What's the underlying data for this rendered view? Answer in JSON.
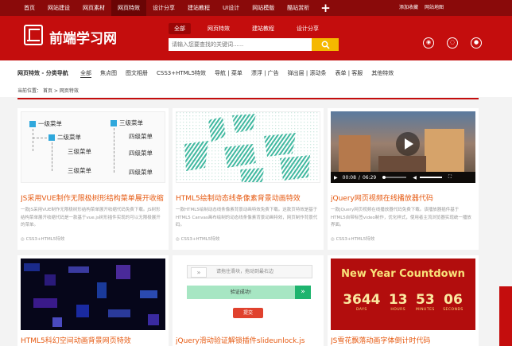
{
  "topnav": {
    "items": [
      "首页",
      "网站建设",
      "网页素材",
      "网页特效",
      "设计分享",
      "建站教程",
      "UI设计",
      "网站模版",
      "酷站赏析"
    ],
    "active_index": 3,
    "right_links": [
      "添加收藏",
      "网站地图"
    ]
  },
  "header": {
    "logo_text": "前端学习网",
    "search_tabs": [
      "全部",
      "网页特效",
      "建站教程",
      "设计分享"
    ],
    "search_placeholder": "请输入您要查找的关键词......",
    "icons": [
      "weibo-icon",
      "qq-icon",
      "penguin-icon"
    ]
  },
  "category": {
    "title": "网页特效 - 分类导航",
    "items": [
      "全部",
      "焦点图",
      "图文相册",
      "CSS3+HTML5特效",
      "导航 | 菜单",
      "漂浮 | 广告",
      "弹出层 | 滚动条",
      "表单 | 客服",
      "其他特效"
    ],
    "active_index": 0
  },
  "breadcrumb": {
    "label": "当前位置：",
    "home": "首页",
    "sep": ">",
    "current": "网页特效"
  },
  "tree_thumb": {
    "n1": "一级菜单",
    "n2": "二级菜单",
    "n3a": "三级菜单",
    "n3b": "三级菜单",
    "r1": "三级菜单",
    "r2": "四级菜单",
    "r3": "四级菜单",
    "r4": "四级菜单"
  },
  "video_thumb": {
    "current_time": "00:08",
    "duration": "06:29"
  },
  "slider_thumb": {
    "placeholder": "请拖住滑块，拖动到最右边",
    "success": "验证成功!",
    "submit": "提交"
  },
  "newyear_thumb": {
    "title": "New Year Countdown",
    "nums": [
      "3644",
      "13",
      "53",
      "06"
    ],
    "labels": [
      "DAYS",
      "HOURS",
      "MINUTES",
      "SECONDS"
    ]
  },
  "cards": [
    {
      "title": "JS采用VUE制作无限极树形结构菜单展开收缩",
      "desc": "一款JS采用VUE制作无限极树形结构菜单展开收缩代码免费下载。JS树形结构菜单展开收缩代码是一款基于vue.js树形插件实现的可以无限极展开的菜单。",
      "tag": "CSS3+HTML5特效"
    },
    {
      "title": "HTML5绘制动态线条像素背景动画特效",
      "desc": "一款HTML5绘制动态线条像素背景动画特效免费下载。这款页特效是基于HTML5 Canvas画布绘制的动态线条像素背景动画特效，网页制作背景代码。",
      "tag": "CSS3+HTML5特效"
    },
    {
      "title": "jQuery网页视频在线播放器代码",
      "desc": "一款jQuery网页视频在线播放器代码免费下载。该播放器插件基于HTML5自带标签video制作，优化样式，使用者主流浏览器实现统一播放界面。",
      "tag": "CSS3+HTML5特效"
    },
    {
      "title": "HTML5科幻空间动画背景网页特效"
    },
    {
      "title": "jQuery滑动验证解锁插件slideunlock.js"
    },
    {
      "title": "JS雪花飘落动画字体倒计时代码"
    }
  ]
}
